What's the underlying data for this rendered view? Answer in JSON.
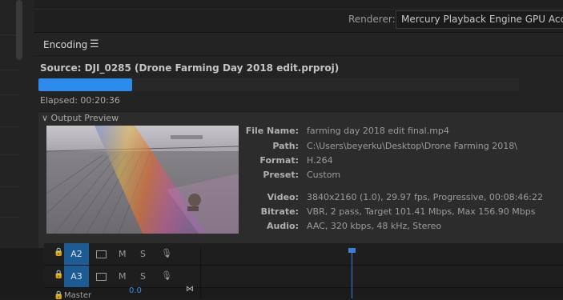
{
  "renderer": {
    "label": "Renderer:",
    "value": "Mercury Playback Engine GPU Acceleration (CUDA)"
  },
  "encoding_panel": {
    "tab_label": "Encoding",
    "menu_icon": "☰",
    "source_text": "Source: DJI_0285 (Drone Farming Day 2018 edit.prproj)",
    "progress_fraction": 0.195,
    "progress_color": "#2d8ceb",
    "elapsed_text": "Elapsed: 00:20:36",
    "output_preview_label": "∨ Output Preview",
    "info": [
      {
        "label": "File Name:",
        "value": "farming day 2018 edit final.mp4"
      },
      {
        "label": "Path:",
        "value": "C:\\Users\\beyerku\\Desktop\\Drone Farming 2018\\"
      },
      {
        "label": "Format:",
        "value": "H.264"
      },
      {
        "label": "Preset:",
        "value": "Custom"
      },
      {
        "label": "Video:",
        "value": "3840x2160 (1.0), 29.97 fps, Progressive, 00:08:46:22"
      },
      {
        "label": "Bitrate:",
        "value": "VBR, 2 pass, Target 101.41 Mbps, Max 156.90 Mbps"
      },
      {
        "label": "Audio:",
        "value": "AAC, 320 kbps, 48 kHz, Stereo"
      }
    ]
  },
  "timeline": {
    "tracks": [
      {
        "id": "A2",
        "mute": "M",
        "solo": "S"
      },
      {
        "id": "A3",
        "mute": "M",
        "solo": "S"
      }
    ],
    "master": {
      "label": "Master",
      "volume": "0.0"
    },
    "playhead_color": "#3b7ed8"
  },
  "icons": {
    "lock": "🔒",
    "mic": "🎙",
    "bowtie": "⋈"
  },
  "colors": {
    "accent": "#2d8ceb",
    "track_selected": "#1d5b94"
  }
}
